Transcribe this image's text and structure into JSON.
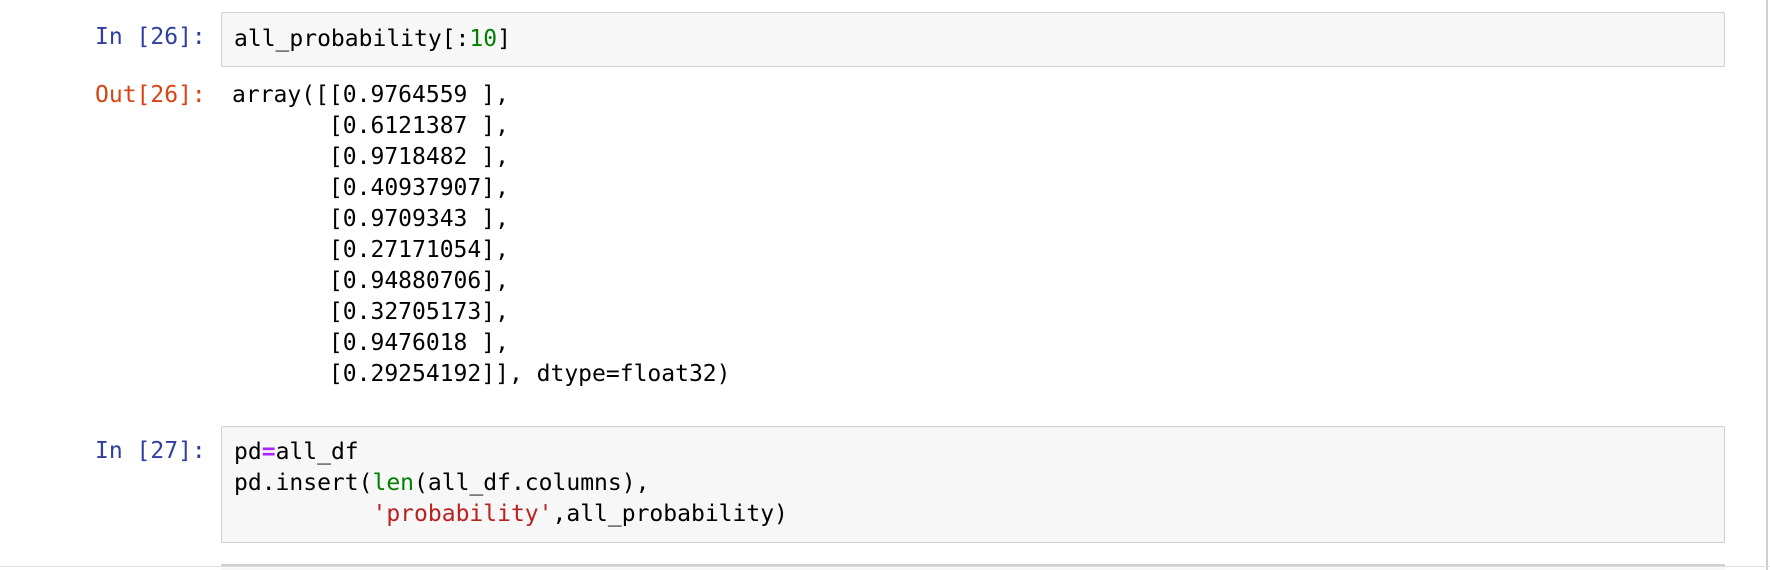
{
  "cells": [
    {
      "type": "code",
      "prompt": "In [26]:",
      "code": {
        "var": "all_probability[:",
        "num": "10",
        "close": "]"
      },
      "output_prompt": "Out[26]:",
      "output": "array([[0.9764559 ],\n       [0.6121387 ],\n       [0.9718482 ],\n       [0.40937907],\n       [0.9709343 ],\n       [0.27171054],\n       [0.94880706],\n       [0.32705173],\n       [0.9476018 ],\n       [0.29254192]], dtype=float32)"
    },
    {
      "type": "code",
      "prompt": "In [27]:",
      "code": {
        "l1_a": "pd",
        "l1_op": "=",
        "l1_b": "all_df",
        "l2_a": "pd.insert(",
        "l2_builtin": "len",
        "l2_b": "(all_df.columns),",
        "l3_indent": "          ",
        "l3_str": "'probability'",
        "l3_b": ",all_probability)"
      }
    }
  ],
  "colors": {
    "in_prompt": "#303f9f",
    "out_prompt": "#d84315",
    "number": "#008000",
    "operator": "#aa22ff",
    "builtin": "#008000",
    "string": "#ba2121",
    "input_bg": "#f7f7f7"
  }
}
